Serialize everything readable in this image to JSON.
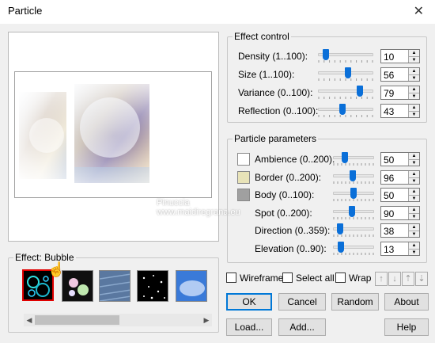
{
  "window": {
    "title": "Particle"
  },
  "watermark": "Pinuccia\nwww.maidiregrana.eu",
  "effect_control": {
    "legend": "Effect control",
    "rows": [
      {
        "label": "Density (1..100):",
        "value": "10",
        "level": 0.09
      },
      {
        "label": "Size (1..100):",
        "value": "56",
        "level": 0.55
      },
      {
        "label": "Variance (0..100):",
        "value": "79",
        "level": 0.79
      },
      {
        "label": "Reflection (0..100):",
        "value": "43",
        "level": 0.43
      }
    ]
  },
  "particle_parameters": {
    "legend": "Particle parameters",
    "rows": [
      {
        "label": "Ambience (0..200):",
        "value": "50",
        "level": 0.25,
        "swatch": "#ffffff"
      },
      {
        "label": "Border (0..200):",
        "value": "96",
        "level": 0.48,
        "swatch": "#e8e3b8"
      },
      {
        "label": "Body (0..100):",
        "value": "50",
        "level": 0.5,
        "swatch": "#a0a0a0"
      },
      {
        "label": "Spot (0..200):",
        "value": "90",
        "level": 0.45,
        "swatch": ""
      },
      {
        "label": "Direction (0..359):",
        "value": "38",
        "level": 0.11,
        "swatch": ""
      },
      {
        "label": "Elevation (0..90):",
        "value": "13",
        "level": 0.14,
        "swatch": ""
      }
    ]
  },
  "effect": {
    "legend": "Effect: Bubble",
    "presets": [
      "bubble",
      "sparkle",
      "rain",
      "stars",
      "clouds"
    ],
    "selected": 0
  },
  "options": {
    "wireframe": "Wireframe",
    "select_all": "Select all",
    "wrap": "Wrap"
  },
  "buttons": {
    "ok": "OK",
    "cancel": "Cancel",
    "random": "Random",
    "about": "About",
    "load": "Load...",
    "add": "Add...",
    "help": "Help"
  },
  "colors": {
    "thumb": "#0a6fd8",
    "focus": "#0078d7",
    "selected_preset": "#e00000"
  }
}
